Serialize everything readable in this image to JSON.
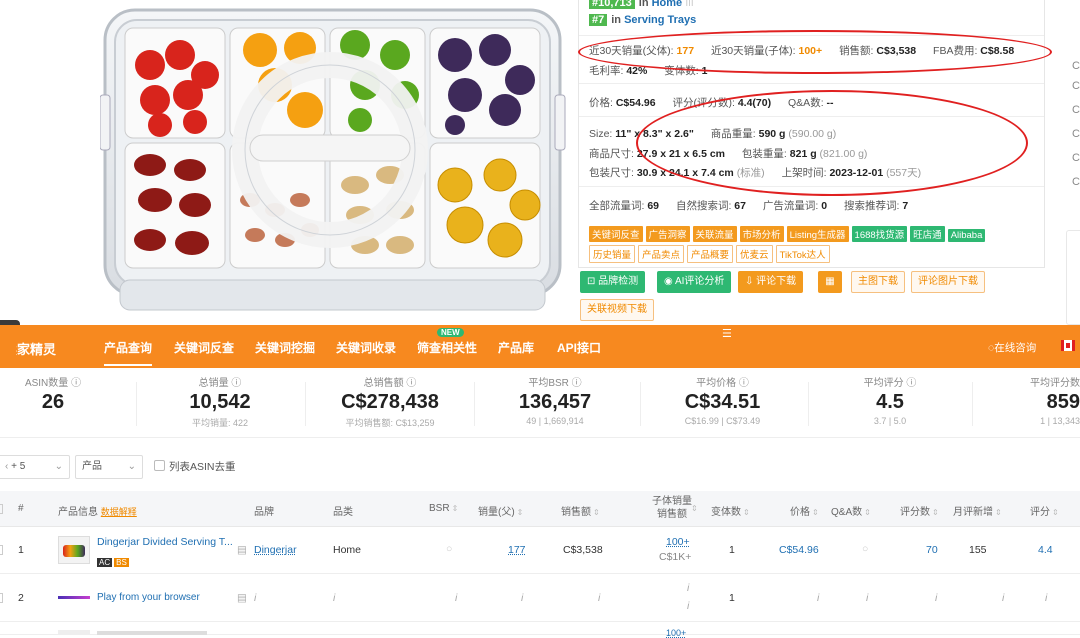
{
  "ranks": [
    {
      "badge": "#10,713",
      "in": "in",
      "category": "Home"
    },
    {
      "badge": "#7",
      "in": "in",
      "category": "Serving Trays"
    }
  ],
  "info": {
    "sales30_parent_label": "近30天销量(父体):",
    "sales30_parent_value": "177",
    "sales30_child_label": "近30天销量(子体):",
    "sales30_child_value": "100+",
    "revenue_label": "销售额:",
    "revenue_value": "C$3,538",
    "fba_label": "FBA费用:",
    "fba_value": "C$8.58",
    "margin_label": "毛利率:",
    "margin_value": "42%",
    "variants_label": "变体数:",
    "variants_value": "1",
    "price_label": "价格:",
    "price_value": "C$54.96",
    "rating_label": "评分(评分数):",
    "rating_value": "4.4(70)",
    "qa_label": "Q&A数:",
    "qa_value": "--",
    "size_label": "Size:",
    "size_value": "11\" x 8.3\" x 2.6\"",
    "weight_label": "商品重量:",
    "weight_value": "590 g",
    "weight_grey": "(590.00 g)",
    "dims_label": "商品尺寸:",
    "dims_value": "27.9 x 21 x 6.5 cm",
    "pkg_weight_label": "包装重量:",
    "pkg_weight_value": "821 g",
    "pkg_weight_grey": "(821.00 g)",
    "pkg_dims_label": "包装尺寸:",
    "pkg_dims_value": "30.9 x 24.1 x 7.4 cm",
    "pkg_dims_grey": "(标准)",
    "listed_label": "上架时间:",
    "listed_value": "2023-12-01",
    "listed_grey": "(557天)",
    "all_kw_label": "全部流量词:",
    "all_kw_value": "69",
    "organic_label": "自然搜索词:",
    "organic_value": "67",
    "ad_label": "广告流量词:",
    "ad_value": "0",
    "rec_label": "搜索推荐词:",
    "rec_value": "7"
  },
  "tags_row1": [
    {
      "t": "关键词反查",
      "s": "o"
    },
    {
      "t": "广告洞察",
      "s": "o"
    },
    {
      "t": "关联流量",
      "s": "o"
    },
    {
      "t": "市场分析",
      "s": "o"
    },
    {
      "t": "Listing生成器",
      "s": "o"
    },
    {
      "t": "1688找货源",
      "s": "g"
    },
    {
      "t": "旺店通",
      "s": "g"
    },
    {
      "t": "Alibaba",
      "s": "g"
    }
  ],
  "tags_row2": [
    {
      "t": "历史销量",
      "s": "ol"
    },
    {
      "t": "产品卖点",
      "s": "ol"
    },
    {
      "t": "产品概要",
      "s": "ol"
    },
    {
      "t": "优麦云",
      "s": "ol"
    },
    {
      "t": "TikTok达人",
      "s": "ol"
    }
  ],
  "buttons": {
    "brand_check": "品牌检测",
    "ai_review": "AI评论分析",
    "review_download": "评论下载",
    "calc_icon": "calculator-icon",
    "main_image_download": "主图下载",
    "review_image_download": "评论图片下载",
    "related_video_download": "关联视频下载"
  },
  "nav": {
    "brand": "卖家精灵",
    "items": [
      "产品查询",
      "关键词反查",
      "关键词挖掘",
      "关键词收录",
      "筛查相关性",
      "产品库",
      "API接口"
    ],
    "new_badge": "NEW",
    "online_consult": "在线咨询",
    "flag": "CA"
  },
  "stats": [
    {
      "title": "ASIN数量",
      "value": "26",
      "sub": ""
    },
    {
      "title": "总销量",
      "value": "10,542",
      "sub": "平均销量: 422"
    },
    {
      "title": "总销售额",
      "value": "C$278,438",
      "sub": "平均销售额: C$13,259"
    },
    {
      "title": "平均BSR",
      "value": "136,457",
      "sub": "49 | 1,669,914"
    },
    {
      "title": "平均价格",
      "value": "C$34.51",
      "sub": "C$16.99 | C$73.49"
    },
    {
      "title": "平均评分",
      "value": "4.5",
      "sub": "3.7 | 5.0"
    },
    {
      "title": "平均评分数",
      "value": "859",
      "sub": "1 | 13,343"
    }
  ],
  "filters": {
    "plus_count": "+ 5",
    "product_select": "产品",
    "dedupe_label": "列表ASIN去重"
  },
  "table": {
    "headers": {
      "num": "#",
      "info": "产品信息",
      "info_link": "数据解释",
      "brand": "品牌",
      "category": "品类",
      "bsr": "BSR",
      "sales_parent": "销量(父)",
      "revenue": "销售额",
      "child_sales_1": "子体销量",
      "child_sales_2": "销售额",
      "variants": "变体数",
      "price": "价格",
      "qa": "Q&A数",
      "reviews": "评分数",
      "monthly_new": "月评新增",
      "rating": "评分"
    },
    "rows": [
      {
        "num": "1",
        "title": "Dingerjar Divided Serving T...",
        "badges": [
          "AC",
          "BS"
        ],
        "brand": "Dingerjar",
        "category": "Home",
        "bsr": "○",
        "sales": "177",
        "revenue": "C$3,538",
        "child_sales": "100+",
        "child_revenue": "C$1K+",
        "variants": "1",
        "price": "C$54.96",
        "qa": "○",
        "reviews": "70",
        "monthly_new": "155",
        "rating": "4.4"
      },
      {
        "num": "2",
        "title": "Play from your browser",
        "brand": "i",
        "category": "i",
        "bsr": "i",
        "sales": "i",
        "revenue": "i",
        "child_sales": "i",
        "child_revenue": "i",
        "variants": "1",
        "price": "i",
        "qa": "i",
        "reviews": "i",
        "monthly_new": "i",
        "rating": "i"
      },
      {
        "num": "",
        "child_sales": "100+"
      }
    ]
  },
  "colors": {
    "nav_orange": "#f7891f",
    "tag_orange": "#f39a1e",
    "tag_green": "#2eb872",
    "link_blue": "#1f6fb2",
    "annotation_red": "#e02020"
  }
}
